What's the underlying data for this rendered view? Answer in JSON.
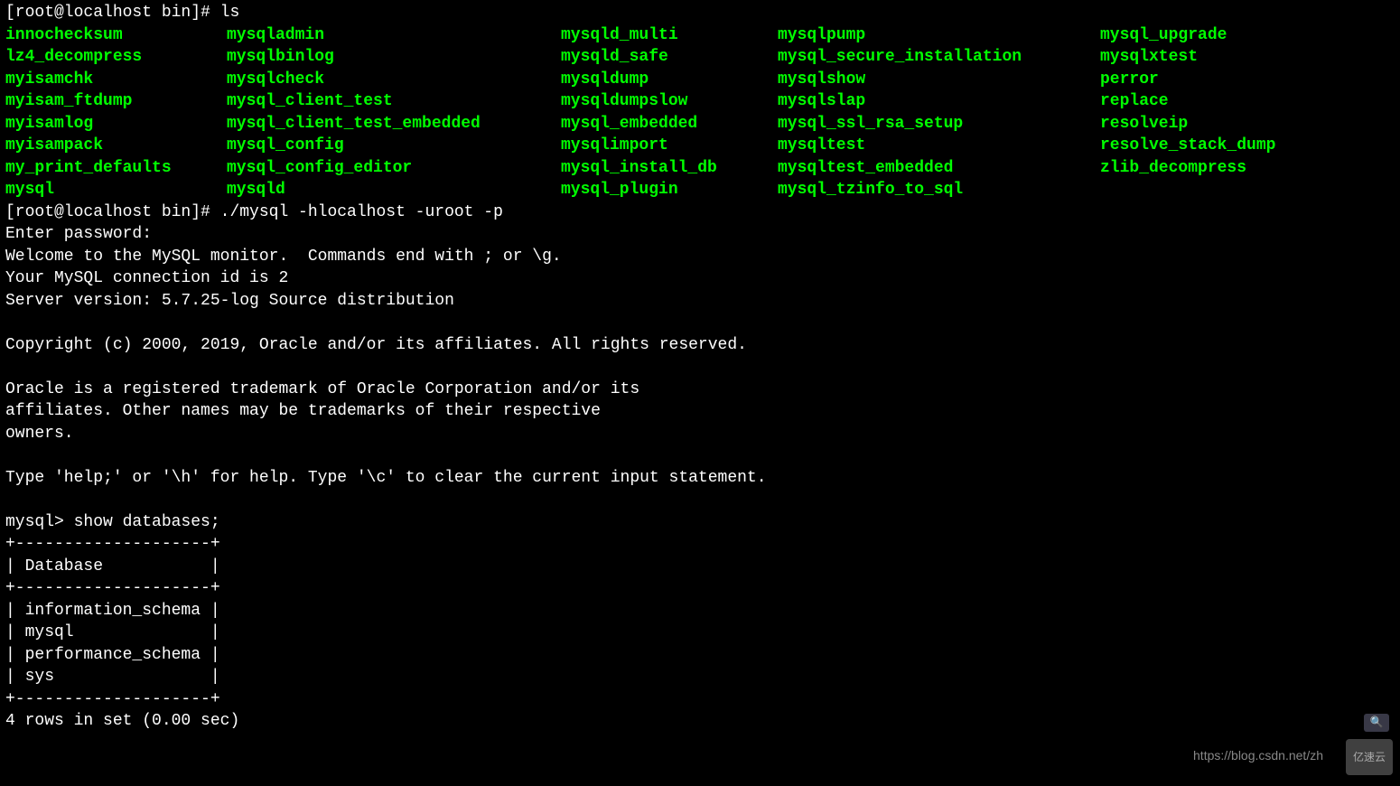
{
  "prompt1": "[root@localhost bin]# ls",
  "ls_columns": [
    [
      "innochecksum",
      "lz4_decompress",
      "myisamchk",
      "myisam_ftdump",
      "myisamlog",
      "myisampack",
      "my_print_defaults",
      "mysql"
    ],
    [
      "mysqladmin",
      "mysqlbinlog",
      "mysqlcheck",
      "mysql_client_test",
      "mysql_client_test_embedded",
      "mysql_config",
      "mysql_config_editor",
      "mysqld"
    ],
    [
      "mysqld_multi",
      "mysqld_safe",
      "mysqldump",
      "mysqldumpslow",
      "mysql_embedded",
      "mysqlimport",
      "mysql_install_db",
      "mysql_plugin"
    ],
    [
      "mysqlpump",
      "mysql_secure_installation",
      "mysqlshow",
      "mysqlslap",
      "mysql_ssl_rsa_setup",
      "mysqltest",
      "mysqltest_embedded",
      "mysql_tzinfo_to_sql"
    ],
    [
      "mysql_upgrade",
      "mysqlxtest",
      "perror",
      "replace",
      "resolveip",
      "resolve_stack_dump",
      "zlib_decompress"
    ]
  ],
  "prompt2": "[root@localhost bin]# ./mysql -hlocalhost -uroot -p",
  "lines": [
    "Enter password:",
    "Welcome to the MySQL monitor.  Commands end with ; or \\g.",
    "Your MySQL connection id is 2",
    "Server version: 5.7.25-log Source distribution",
    "",
    "Copyright (c) 2000, 2019, Oracle and/or its affiliates. All rights reserved.",
    "",
    "Oracle is a registered trademark of Oracle Corporation and/or its",
    "affiliates. Other names may be trademarks of their respective",
    "owners.",
    "",
    "Type 'help;' or '\\h' for help. Type '\\c' to clear the current input statement.",
    "",
    "mysql> show databases;",
    "+--------------------+",
    "| Database           |",
    "+--------------------+",
    "| information_schema |",
    "| mysql              |",
    "| performance_schema |",
    "| sys                |",
    "+--------------------+",
    "4 rows in set (0.00 sec)"
  ],
  "watermark_text": "https://blog.csdn.net/zh",
  "watermark_logo": "亿速云"
}
